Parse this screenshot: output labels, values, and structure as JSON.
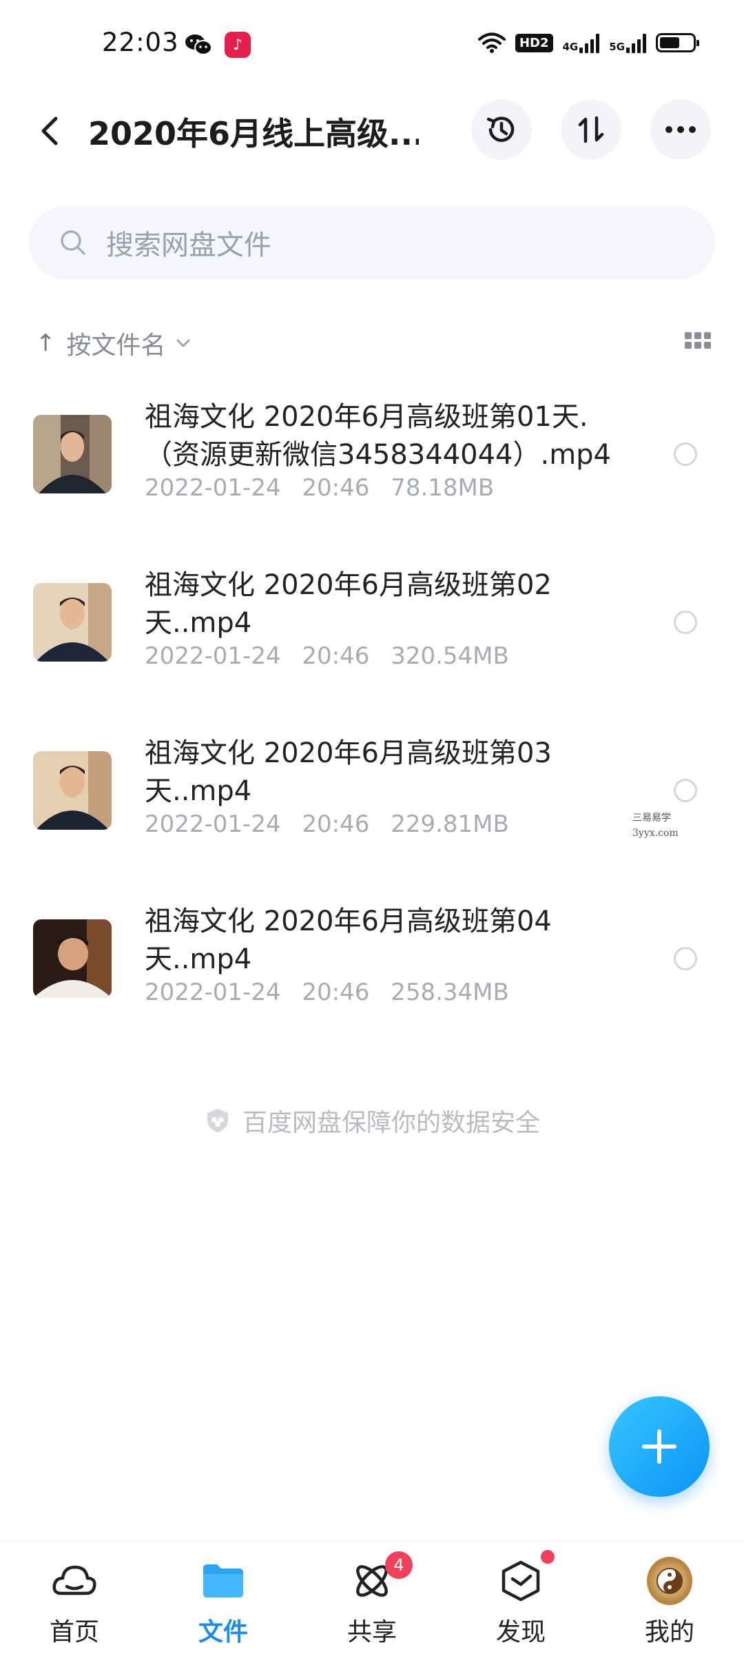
{
  "status_bar": {
    "time": "22:03",
    "app_icons": [
      "wechat-icon",
      "tiktok-icon"
    ],
    "hd_label": "HD2",
    "network_1": "4G",
    "network_2": "5G"
  },
  "header": {
    "title": "2020年6月线上高级...",
    "actions": [
      "history-icon",
      "sort-transfer-icon",
      "more-icon"
    ]
  },
  "search": {
    "placeholder": "搜索网盘文件"
  },
  "sort": {
    "label": "按文件名"
  },
  "files": [
    {
      "name": "祖海文化 2020年6月高级班第01天.（资源更新微信3458344044）.mp4",
      "date": "2022-01-24",
      "time": "20:46",
      "size": "78.18MB"
    },
    {
      "name": "祖海文化 2020年6月高级班第02天..mp4",
      "date": "2022-01-24",
      "time": "20:46",
      "size": "320.54MB"
    },
    {
      "name": "祖海文化 2020年6月高级班第03天..mp4",
      "date": "2022-01-24",
      "time": "20:46",
      "size": "229.81MB"
    },
    {
      "name": "祖海文化 2020年6月高级班第04天..mp4",
      "date": "2022-01-24",
      "time": "20:46",
      "size": "258.34MB"
    }
  ],
  "watermark": {
    "line1": "三易易学",
    "line2": "3yyx.com"
  },
  "safety_note": "百度网盘保障你的数据安全",
  "tabs": [
    {
      "label": "首页",
      "icon": "home-cloud-icon",
      "active": false
    },
    {
      "label": "文件",
      "icon": "folder-icon",
      "active": true
    },
    {
      "label": "共享",
      "icon": "share-atom-icon",
      "active": false,
      "badge": "4"
    },
    {
      "label": "发现",
      "icon": "discover-box-icon",
      "active": false,
      "dot": true
    },
    {
      "label": "我的",
      "icon": "avatar-icon",
      "active": false
    }
  ],
  "colors": {
    "accent": "#1a8cf0",
    "badge": "#f0405c",
    "meta_text": "#a7abb2"
  }
}
